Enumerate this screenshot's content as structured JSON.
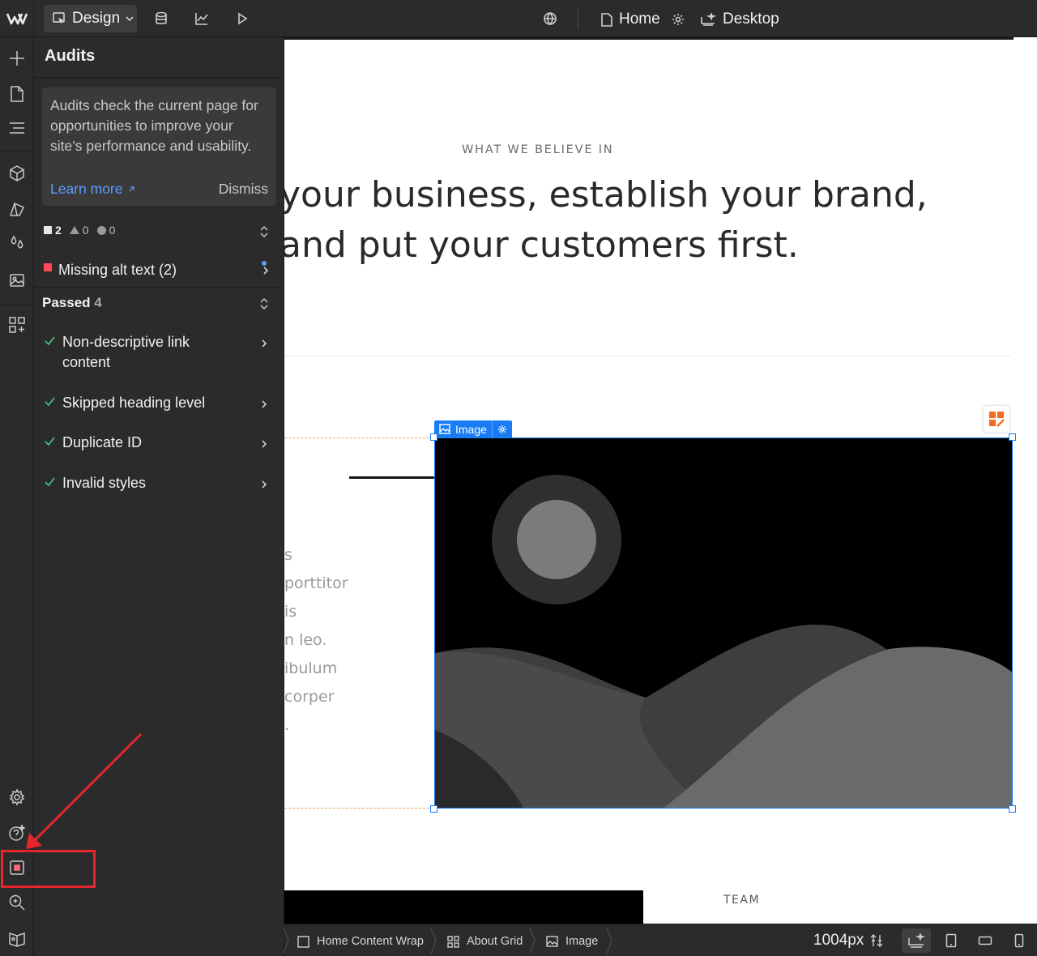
{
  "topbar": {
    "mode_label": "Design",
    "page_label": "Home",
    "breakpoint_label": "Desktop"
  },
  "panel": {
    "title": "Audits",
    "info_text": "Audits check the current page for opportunities to improve your site’s performance and usability.",
    "learn_more": "Learn more",
    "dismiss": "Dismiss",
    "counts": {
      "errors": "2",
      "warnings": "0",
      "suggestions": "0"
    },
    "issue": {
      "label": "Missing alt text (2)"
    },
    "passed_label": "Passed",
    "passed_count": "4",
    "passed_items": [
      {
        "label": "Non-descriptive link content"
      },
      {
        "label": "Skipped heading level"
      },
      {
        "label": "Duplicate ID"
      },
      {
        "label": "Invalid styles"
      }
    ]
  },
  "canvas": {
    "eyebrow": "WHAT WE BELIEVE IN",
    "headline": "your business, establish your brand,\nand put your customers first.",
    "body_text": "s\nporttitor\nis\nn leo.\nibulum\ncorper\n.",
    "image_tag": "Image",
    "team_label": "TEAM"
  },
  "statusbar": {
    "breadcrumbs": [
      {
        "label": "Home Content Wrap",
        "icon": "square-icon"
      },
      {
        "label": "About Grid",
        "icon": "grid-icon"
      },
      {
        "label": "Image",
        "icon": "image-icon"
      }
    ],
    "width_readout": "1004px"
  },
  "colors": {
    "ui_bg": "#2b2b2b",
    "accent_blue": "#1a7cf5",
    "error_red": "#ff4b55",
    "pass_green": "#3fbf7a",
    "annotation_red": "#e5262d"
  }
}
